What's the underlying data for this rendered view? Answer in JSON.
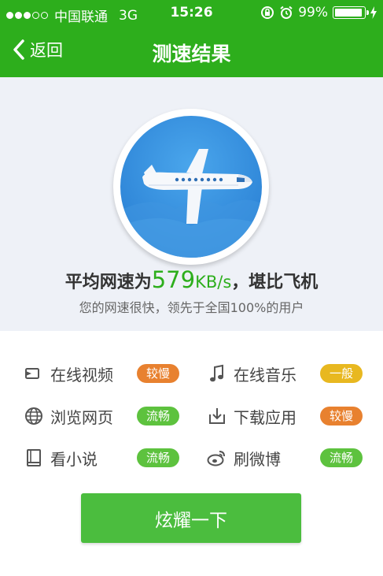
{
  "status": {
    "carrier": "中国联通",
    "network": "3G",
    "time": "15:26",
    "battery": "99%"
  },
  "nav": {
    "back_label": "返回",
    "title": "测速结果"
  },
  "result": {
    "headline_prefix": "平均网速为",
    "speed": "579",
    "unit": "KB/s",
    "headline_suffix": "，堪比飞机",
    "subline": "您的网速很快，领先于全国100%的用户"
  },
  "apps": [
    {
      "label": "在线视频",
      "status": "较慢",
      "icon": "video-icon",
      "color": "#e8812f"
    },
    {
      "label": "在线音乐",
      "status": "一般",
      "icon": "music-note-icon",
      "color": "#e8b820"
    },
    {
      "label": "浏览网页",
      "status": "流畅",
      "icon": "globe-icon",
      "color": "#5dc23e"
    },
    {
      "label": "下载应用",
      "status": "较慢",
      "icon": "download-icon",
      "color": "#e8812f"
    },
    {
      "label": "看小说",
      "status": "流畅",
      "icon": "book-icon",
      "color": "#5dc23e"
    },
    {
      "label": "刷微博",
      "status": "流畅",
      "icon": "weibo-icon",
      "color": "#5dc23e"
    }
  ],
  "share_button": "炫耀一下",
  "colors": {
    "brand_green": "#2dae1c",
    "button_green": "#4bbd3e",
    "badge_blue": "#2f86d8"
  }
}
